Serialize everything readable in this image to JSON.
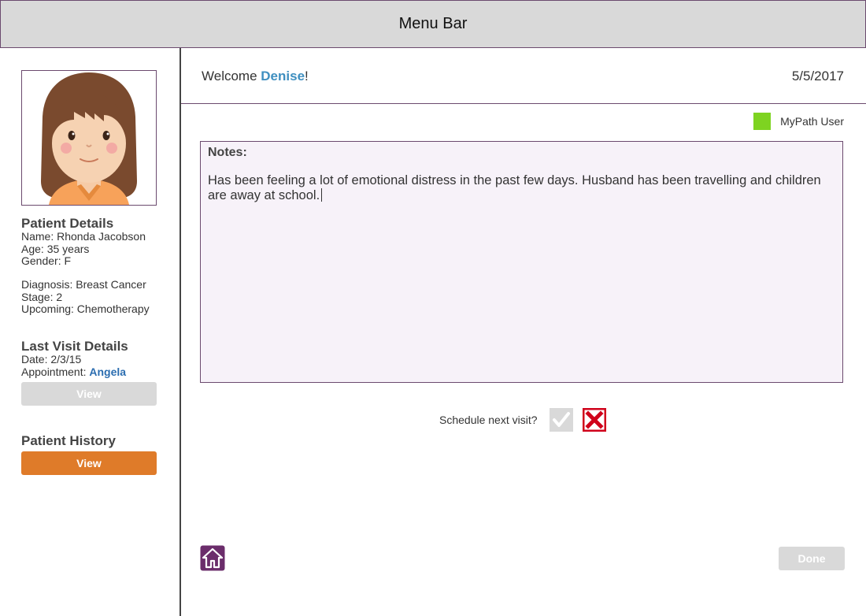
{
  "menubar": {
    "title": "Menu Bar"
  },
  "patient_details": {
    "title": "Patient Details",
    "name": "Name: Rhonda Jacobson",
    "age": "Age: 35 years",
    "gender": "Gender: F",
    "diagnosis": "Diagnosis: Breast Cancer",
    "stage": "Stage: 2",
    "upcoming": "Upcoming: Chemotherapy"
  },
  "last_visit": {
    "title": "Last Visit Details",
    "date": "Date: 2/3/15",
    "appointment_label": "Appointment:",
    "appointment_name": "Angela",
    "view_label": "View"
  },
  "patient_history": {
    "title": "Patient History",
    "view_label": "View"
  },
  "header": {
    "welcome_prefix": "Welcome",
    "user_name": "Denise",
    "welcome_suffix": "!",
    "date": "5/5/2017"
  },
  "legend": {
    "label": "MyPath User",
    "color": "#7ed321"
  },
  "notes": {
    "label": "Notes:",
    "text": "Has been feeling a lot of emotional distress in the past few days. Husband has been travelling and children are away at school."
  },
  "schedule": {
    "label": "Schedule next visit?",
    "yes_icon": "check-icon",
    "no_icon": "x-icon"
  },
  "footer": {
    "home_icon": "home-icon",
    "done_label": "Done"
  },
  "colors": {
    "accent_orange": "#df7b29",
    "link_blue": "#2b6db0",
    "name_blue": "#3f8fc0",
    "purple": "#6b4a6e",
    "danger_red": "#d0021b"
  }
}
